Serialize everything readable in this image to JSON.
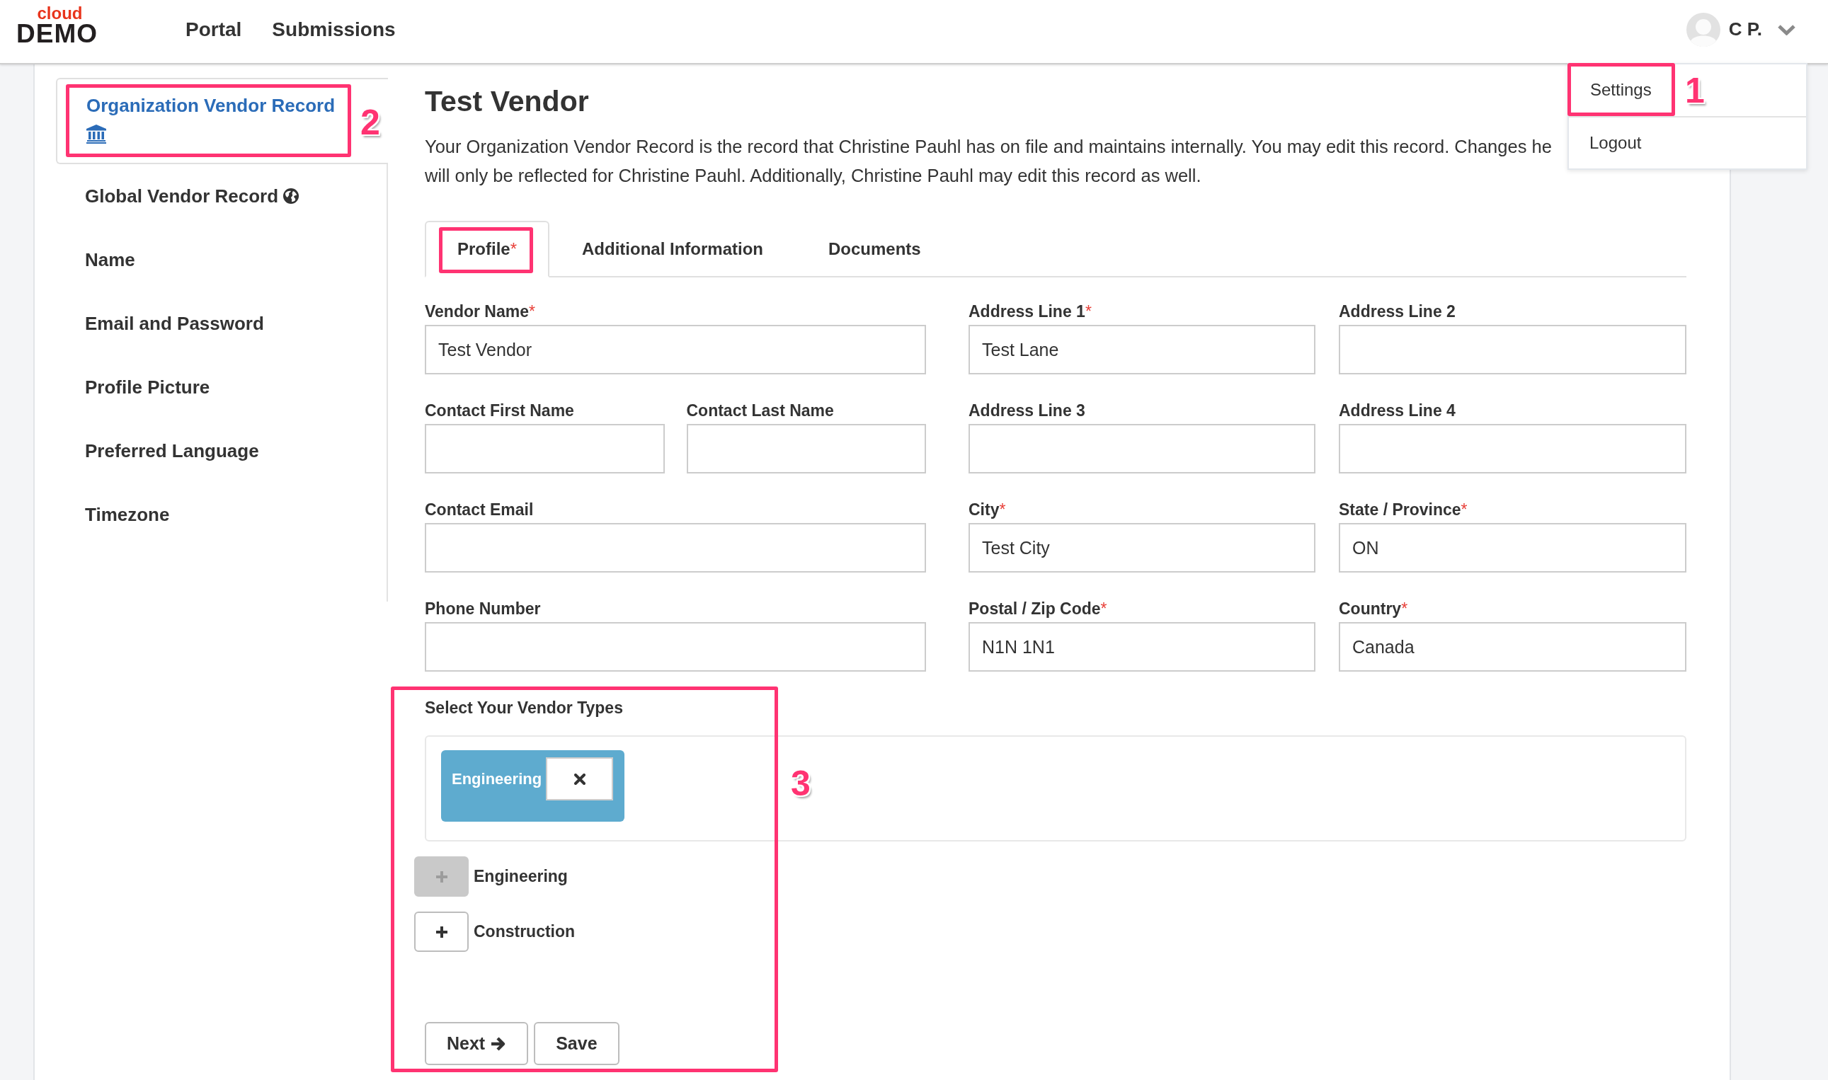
{
  "header": {
    "logo": {
      "top": "cloud",
      "bottom": "DEMO"
    },
    "nav": [
      {
        "label": "Portal"
      },
      {
        "label": "Submissions"
      }
    ],
    "user": {
      "initials": "C P."
    }
  },
  "user_menu": {
    "expanded": true,
    "items": [
      {
        "label": "Settings",
        "annotated": true,
        "callout": "1"
      },
      {
        "label": "Logout",
        "annotated": false
      }
    ]
  },
  "sidebar": {
    "items": [
      {
        "label": "Organization Vendor Record",
        "kind": "organization",
        "selected": true,
        "annotated": true,
        "callout": "2"
      },
      {
        "label": "Global Vendor Record",
        "kind": "global",
        "selected": false,
        "annotated": false
      },
      {
        "label": "Name",
        "kind": "setting",
        "selected": false,
        "annotated": false
      },
      {
        "label": "Email and Password",
        "kind": "setting",
        "selected": false,
        "annotated": false
      },
      {
        "label": "Profile Picture",
        "kind": "setting",
        "selected": false,
        "annotated": false
      },
      {
        "label": "Preferred Language",
        "kind": "setting",
        "selected": false,
        "annotated": false
      },
      {
        "label": "Timezone",
        "kind": "setting",
        "selected": false,
        "annotated": false
      }
    ]
  },
  "page": {
    "title": "Test Vendor",
    "description_lines": [
      "Your Organization Vendor Record is the record that Christine Pauhl has on file and maintains internally. You may edit this record. Changes he",
      "will only be reflected for Christine Pauhl. Additionally, Christine Pauhl may edit this record as well."
    ]
  },
  "tabs": [
    {
      "label": "Profile",
      "required_mark": "*",
      "selected": true,
      "annotated": true
    },
    {
      "label": "Additional Information",
      "selected": false,
      "annotated": false
    },
    {
      "label": "Documents",
      "selected": false,
      "annotated": false
    }
  ],
  "form_rows": [
    [
      {
        "label": "Vendor Name",
        "required_mark": "*",
        "value": "Test Vendor"
      },
      {
        "label": "Address Line 1",
        "required_mark": "*",
        "value": "Test Lane"
      },
      {
        "label": "Address Line 2"
      }
    ],
    [
      {
        "label": "Contact First Name"
      },
      {
        "label": "Contact Last Name"
      },
      {
        "label": "Address Line 3"
      },
      {
        "label": "Address Line 4"
      }
    ],
    [
      {
        "label": "Contact Email"
      },
      {
        "label": "City",
        "required_mark": "*",
        "value": "Test City"
      },
      {
        "label": "State / Province",
        "required_mark": "*",
        "value": "ON"
      }
    ],
    [
      {
        "label": "Phone Number"
      },
      {
        "label": "Postal / Zip Code",
        "required_mark": "*",
        "value": "N1N 1N1"
      },
      {
        "label": "Country",
        "required_mark": "*",
        "value": "Canada"
      }
    ]
  ],
  "vendor_types": {
    "label": "Select Your Vendor Types",
    "chosen": [
      {
        "label": "Engineering"
      }
    ],
    "options": [
      {
        "label": "Engineering",
        "disabled": true
      },
      {
        "label": "Construction",
        "disabled": false
      }
    ],
    "annotated": true,
    "callout": "3"
  },
  "actions": [
    {
      "label": "Next",
      "kind": "forward"
    },
    {
      "label": "Save",
      "kind": "plain"
    }
  ]
}
